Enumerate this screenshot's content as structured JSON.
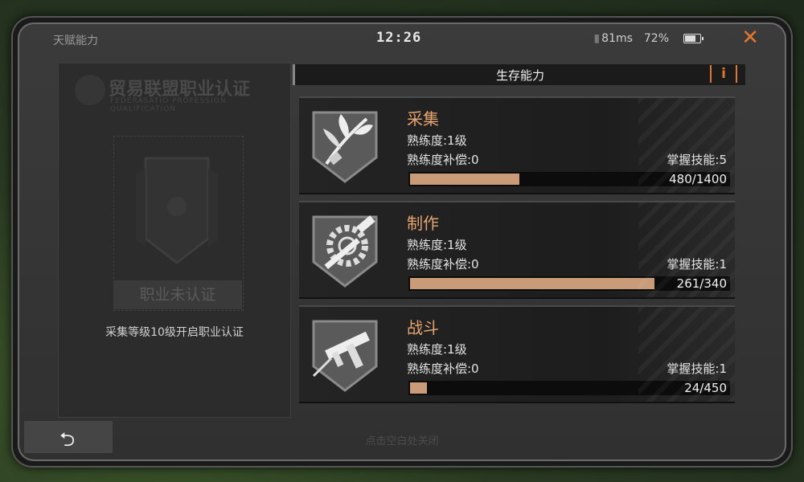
{
  "status": {
    "title": "天赋能力",
    "time": "12:26",
    "ping": "81ms",
    "battery": "72%"
  },
  "certification": {
    "title": "贸易联盟职业认证",
    "subtitle": "FEDERASATIO PROFESSION QUALIFICATION",
    "status": "职业未认证",
    "hint": "采集等级10级开启职业认证"
  },
  "section": {
    "title": "生存能力",
    "info_label": "i"
  },
  "skills": [
    {
      "name": "采集",
      "level": "熟练度:1级",
      "compensation": "熟练度补偿:0",
      "mastery": "掌握技能:5",
      "progress_text": "480/1400",
      "current": 480,
      "max": 1400,
      "icon": "herb-icon"
    },
    {
      "name": "制作",
      "level": "熟练度:1级",
      "compensation": "熟练度补偿:0",
      "mastery": "掌握技能:1",
      "progress_text": "261/340",
      "current": 261,
      "max": 340,
      "icon": "gear-hammer-icon"
    },
    {
      "name": "战斗",
      "level": "熟练度:1级",
      "compensation": "熟练度补偿:0",
      "mastery": "掌握技能:1",
      "progress_text": "24/450",
      "current": 24,
      "max": 450,
      "icon": "gun-icon"
    }
  ],
  "footer": {
    "hint": "点击空白处关闭",
    "back_symbol": "⮌"
  },
  "colors": {
    "accent": "#e0772c",
    "skill_name": "#e6a46f",
    "progress_fill": "#c99b78"
  }
}
